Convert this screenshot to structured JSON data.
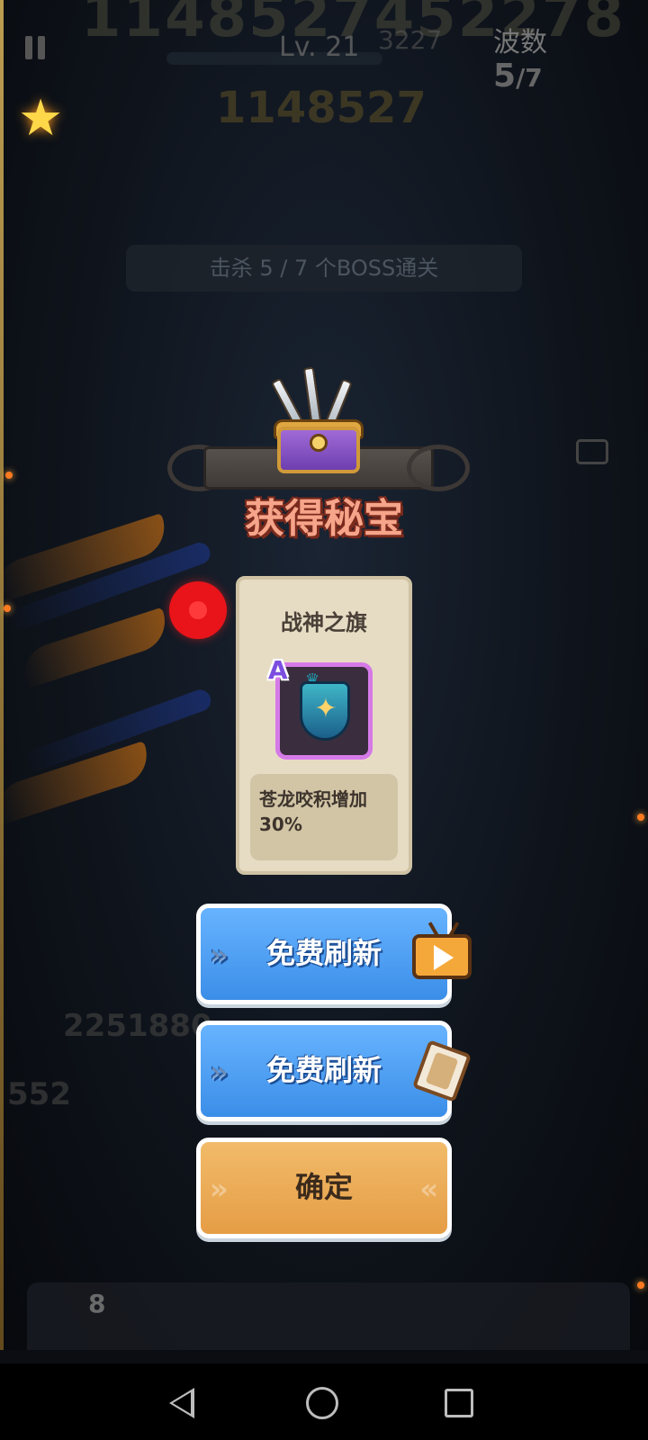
{
  "hud": {
    "big_number": "1148527452278",
    "level": "Lv. 21",
    "score_secondary": "3227",
    "wave_label": "波数",
    "wave_current": "5",
    "wave_total": "/7",
    "score": "1148527",
    "objective": "击杀 5 / 7 个BOSS通关"
  },
  "background": {
    "numbers": [
      "2251880",
      "552"
    ],
    "dock_counter": "8"
  },
  "modal": {
    "title": "获得秘宝",
    "card": {
      "name": "战神之旗",
      "rarity": "A",
      "description": "苍龙咬积增加30%"
    },
    "buttons": {
      "refresh_video": "免费刷新",
      "refresh_card": "免费刷新",
      "confirm": "确定"
    }
  },
  "icons": {
    "pause": "pause-icon",
    "star": "star-icon",
    "video": "video-play-icon",
    "card": "card-icon",
    "record": "record-dot-icon"
  },
  "colors": {
    "title": "#f6a48a",
    "button_blue": "#4f9ff2",
    "button_orange": "#eaa752",
    "rarity": "#7b4ee0",
    "record": "#e8141a"
  },
  "navbar": {
    "back": "back-icon",
    "home": "home-icon",
    "recents": "recents-icon"
  }
}
